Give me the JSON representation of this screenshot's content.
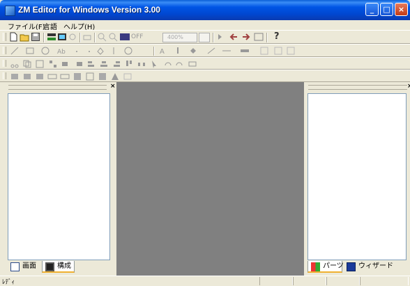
{
  "window": {
    "title": "ZM Editor for Windows Version 3.00",
    "minimize_glyph": "_",
    "maximize_glyph": "□",
    "close_glyph": "×"
  },
  "menubar": {
    "items": [
      {
        "label": "ファイル(F)"
      },
      {
        "label": "言語"
      },
      {
        "label": "ヘルプ(H)"
      }
    ]
  },
  "toolbar1": {
    "off_label": "OFF",
    "zoom_value": "400%",
    "help_glyph": "?"
  },
  "left_panel": {
    "close_glyph": "×",
    "tabs": [
      {
        "label": "画面",
        "icon": "screen-icon"
      },
      {
        "label": "構成",
        "icon": "structure-icon"
      }
    ],
    "active_tab": "構成"
  },
  "right_panel": {
    "close_glyph": "×",
    "tabs": [
      {
        "label": "パーツ",
        "icon": "parts-icon"
      },
      {
        "label": "ウィザード",
        "icon": "wizard-icon"
      }
    ],
    "active_tab": "パーツ"
  },
  "statusbar": {
    "text": "ﾚﾃﾞｨ"
  },
  "colors": {
    "titlebar": "#0055e5",
    "workspace": "#808080",
    "face": "#ece9d8"
  }
}
